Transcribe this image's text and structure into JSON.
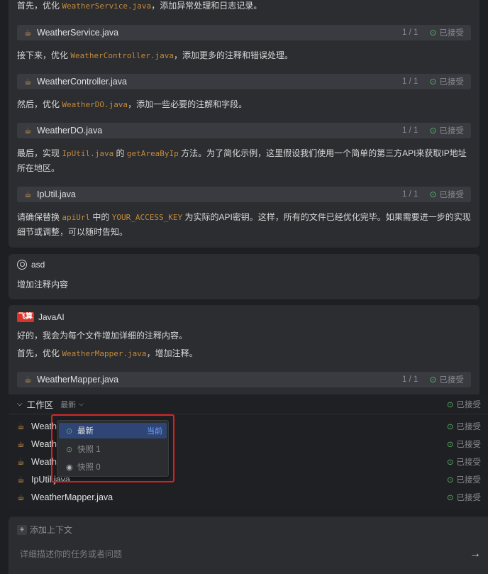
{
  "message1": {
    "intro_prefix": "首先，优化 ",
    "intro_code": "WeatherService.java",
    "intro_suffix": "，添加异常处理和日志记录。",
    "file1": {
      "name": "WeatherService.java",
      "count": "1 / 1",
      "status": "已接受"
    },
    "line2_prefix": "接下来，优化 ",
    "line2_code": "WeatherController.java",
    "line2_suffix": "，添加更多的注释和错误处理。",
    "file2": {
      "name": "WeatherController.java",
      "count": "1 / 1",
      "status": "已接受"
    },
    "line3_prefix": "然后，优化 ",
    "line3_code": "WeatherDO.java",
    "line3_suffix": "，添加一些必要的注解和字段。",
    "file3": {
      "name": "WeatherDO.java",
      "count": "1 / 1",
      "status": "已接受"
    },
    "line4_prefix": "最后，实现 ",
    "line4_code1": "IpUtil.java",
    "line4_mid": " 的 ",
    "line4_code2": "getAreaByIp",
    "line4_suffix": " 方法。为了简化示例，这里假设我们使用一个简单的第三方API来获取IP地址所在地区。",
    "file4": {
      "name": "IpUtil.java",
      "count": "1 / 1",
      "status": "已接受"
    },
    "line5_prefix": "请确保替换 ",
    "line5_code1": "apiUrl",
    "line5_mid": " 中的 ",
    "line5_code2": "YOUR_ACCESS_KEY",
    "line5_suffix": " 为实际的API密钥。这样，所有的文件已经优化完毕。如果需要进一步的实现细节或调整，可以随时告知。"
  },
  "user_message": {
    "name": "asd",
    "text": "增加注释内容"
  },
  "message2": {
    "logo": "飞算",
    "name": "JavaAI",
    "line1": "好的，我会为每个文件增加详细的注释内容。",
    "line2_prefix": "首先，优化 ",
    "line2_code": "WeatherMapper.java",
    "line2_suffix": "，增加注释。",
    "file1": {
      "name": "WeatherMapper.java",
      "count": "1 / 1",
      "status": "已接受"
    }
  },
  "workspace": {
    "title": "工作区",
    "version": "最新",
    "header_status": "已接受",
    "files": [
      {
        "name": "WeatherService.java",
        "status": "已接受"
      },
      {
        "name": "WeatherController.java",
        "status": "已接受"
      },
      {
        "name": "WeatherDO.java",
        "status": "已接受"
      },
      {
        "name": "IpUtil.java",
        "status": "已接受"
      },
      {
        "name": "WeatherMapper.java",
        "status": "已接受"
      }
    ]
  },
  "version_dropdown": {
    "items": [
      {
        "label": "最新",
        "tag": "当前",
        "icon": "check-circle-icon"
      },
      {
        "label": "快照 1",
        "icon": "check-circle-icon"
      },
      {
        "label": "快照 0",
        "icon": "target-icon"
      }
    ]
  },
  "composer": {
    "add_context": "添加上下文",
    "placeholder": "详细描述你的任务或者问题",
    "send_icon": "arrow-right-icon"
  },
  "colors": {
    "accent": "#2f4576",
    "accepted": "#5fae6a",
    "highlight_border": "#e02020",
    "code": "#c58a3c"
  }
}
